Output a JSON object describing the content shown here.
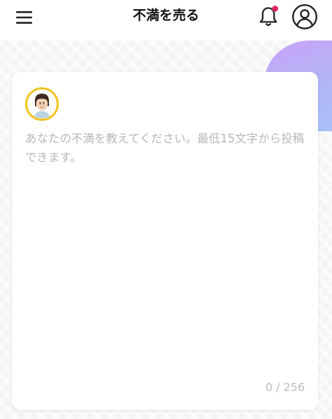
{
  "header": {
    "title": "不満を売る",
    "menu_icon": "hamburger-menu-icon",
    "notification_icon": "bell-icon",
    "account_icon": "user-account-icon",
    "notification_dot_color": "#e0245e"
  },
  "composer": {
    "avatar_icon": "user-avatar-icon",
    "avatar_ring_color": "#f2c31b",
    "placeholder": "あなたの不満を教えてください。最低15文字から投稿できます。",
    "char_count": "0 / 256"
  }
}
